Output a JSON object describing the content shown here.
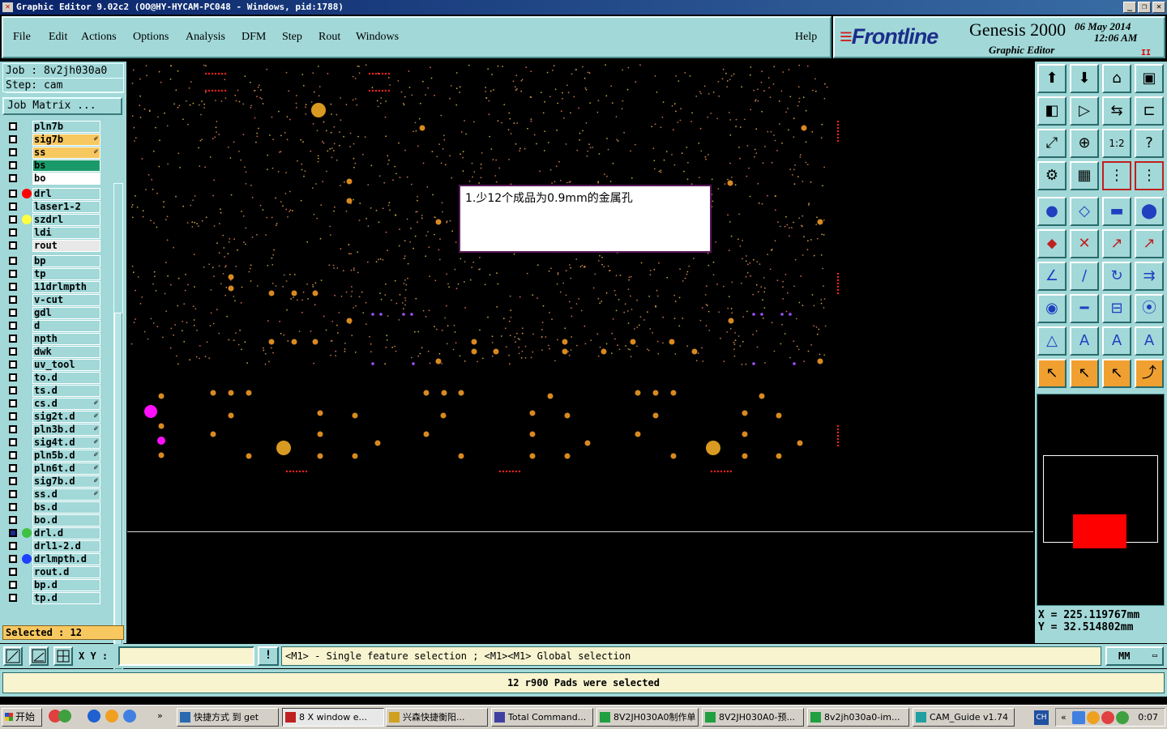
{
  "window": {
    "title": "Graphic Editor 9.02c2 (OO@HY-HYCAM-PC048 - Windows, pid:1788)",
    "controls": [
      "_",
      "❐",
      "✕"
    ]
  },
  "menu": {
    "items": [
      "File",
      "Edit",
      "Actions",
      "Options",
      "Analysis",
      "DFM",
      "Step",
      "Rout",
      "Windows"
    ],
    "help": "Help"
  },
  "brand": {
    "logo": "Frontline",
    "product": "Genesis 2000",
    "subtitle": "Graphic Editor",
    "date": "06 May 2014",
    "time": "12:06 AM",
    "pause": "II"
  },
  "job": {
    "job_line": "Job : 8v2jh030a0",
    "step_line": "Step: cam",
    "matrix_button": "Job Matrix ..."
  },
  "layers": [
    {
      "name": "pln7b",
      "bg": "#a2d8d8",
      "dot": "",
      "edit": false,
      "cb": "#ffffff"
    },
    {
      "name": "sig7b",
      "bg": "#f8c860",
      "dot": "",
      "edit": true,
      "cb": "#ffffff"
    },
    {
      "name": "ss",
      "bg": "#f8c860",
      "dot": "",
      "edit": true,
      "cb": "#ffffff"
    },
    {
      "name": "bs",
      "bg": "#1a9a6a",
      "dot": "",
      "edit": false,
      "cb": "#ffffff"
    },
    {
      "name": "bo",
      "bg": "#ffffff",
      "dot": "",
      "edit": false,
      "cb": "#ffffff"
    },
    {
      "name": "drl",
      "bg": "#a2d8d8",
      "dot": "#ff0000",
      "edit": false,
      "cb": "#ffffff"
    },
    {
      "name": "laser1-2",
      "bg": "#a2d8d8",
      "dot": "",
      "edit": false,
      "cb": "#ffffff"
    },
    {
      "name": "szdrl",
      "bg": "#a2d8d8",
      "dot": "#ffff40",
      "edit": false,
      "cb": "#ffffff"
    },
    {
      "name": "ldi",
      "bg": "#a2d8d8",
      "dot": "",
      "edit": false,
      "cb": "#ffffff"
    },
    {
      "name": "rout",
      "bg": "#e8e8e8",
      "dot": "",
      "edit": false,
      "cb": "#ffffff"
    },
    {
      "name": "bp",
      "bg": "#a2d8d8",
      "dot": "",
      "edit": false,
      "cb": "#ffffff"
    },
    {
      "name": "tp",
      "bg": "#a2d8d8",
      "dot": "",
      "edit": false,
      "cb": "#ffffff"
    },
    {
      "name": "11drlmpth",
      "bg": "#a2d8d8",
      "dot": "",
      "edit": false,
      "cb": "#ffffff"
    },
    {
      "name": "v-cut",
      "bg": "#a2d8d8",
      "dot": "",
      "edit": false,
      "cb": "#ffffff"
    },
    {
      "name": "gdl",
      "bg": "#a2d8d8",
      "dot": "",
      "edit": false,
      "cb": "#ffffff"
    },
    {
      "name": "d",
      "bg": "#a2d8d8",
      "dot": "",
      "edit": false,
      "cb": "#ffffff"
    },
    {
      "name": "npth",
      "bg": "#a2d8d8",
      "dot": "",
      "edit": false,
      "cb": "#ffffff"
    },
    {
      "name": "dwk",
      "bg": "#a2d8d8",
      "dot": "",
      "edit": false,
      "cb": "#ffffff"
    },
    {
      "name": "uv_tool",
      "bg": "#a2d8d8",
      "dot": "",
      "edit": false,
      "cb": "#ffffff"
    },
    {
      "name": "to.d",
      "bg": "#a2d8d8",
      "dot": "",
      "edit": false,
      "cb": "#ffffff"
    },
    {
      "name": "ts.d",
      "bg": "#a2d8d8",
      "dot": "",
      "edit": false,
      "cb": "#ffffff"
    },
    {
      "name": "cs.d",
      "bg": "#a2d8d8",
      "dot": "",
      "edit": true,
      "cb": "#ffffff"
    },
    {
      "name": "sig2t.d",
      "bg": "#a2d8d8",
      "dot": "",
      "edit": true,
      "cb": "#ffffff"
    },
    {
      "name": "pln3b.d",
      "bg": "#a2d8d8",
      "dot": "",
      "edit": true,
      "cb": "#ffffff"
    },
    {
      "name": "sig4t.d",
      "bg": "#a2d8d8",
      "dot": "",
      "edit": true,
      "cb": "#ffffff"
    },
    {
      "name": "pln5b.d",
      "bg": "#a2d8d8",
      "dot": "",
      "edit": true,
      "cb": "#ffffff"
    },
    {
      "name": "pln6t.d",
      "bg": "#a2d8d8",
      "dot": "",
      "edit": true,
      "cb": "#ffffff"
    },
    {
      "name": "sig7b.d",
      "bg": "#a2d8d8",
      "dot": "",
      "edit": true,
      "cb": "#ffffff"
    },
    {
      "name": "ss.d",
      "bg": "#a2d8d8",
      "dot": "",
      "edit": true,
      "cb": "#ffffff"
    },
    {
      "name": "bs.d",
      "bg": "#a2d8d8",
      "dot": "",
      "edit": false,
      "cb": "#ffffff"
    },
    {
      "name": "bo.d",
      "bg": "#a2d8d8",
      "dot": "",
      "edit": false,
      "cb": "#ffffff"
    },
    {
      "name": "drl.d",
      "bg": "#a2d8d8",
      "dot": "#40c040",
      "edit": false,
      "cb": "#1a2a8a"
    },
    {
      "name": "drl1-2.d",
      "bg": "#a2d8d8",
      "dot": "",
      "edit": false,
      "cb": "#ffffff"
    },
    {
      "name": "drlmpth.d",
      "bg": "#a2d8d8",
      "dot": "#2040ff",
      "edit": false,
      "cb": "#ffffff"
    },
    {
      "name": "rout.d",
      "bg": "#a2d8d8",
      "dot": "",
      "edit": false,
      "cb": "#ffffff"
    },
    {
      "name": "bp.d",
      "bg": "#a2d8d8",
      "dot": "",
      "edit": false,
      "cb": "#ffffff"
    },
    {
      "name": "tp.d",
      "bg": "#a2d8d8",
      "dot": "",
      "edit": false,
      "cb": "#ffffff"
    }
  ],
  "selected_label": "Selected : 12",
  "canvas": {
    "note": "1.少12个成品为0.9mm的金属孔"
  },
  "coords": {
    "x": "X = 225.119767mm",
    "y": "Y = 32.514802mm"
  },
  "bottom": {
    "xy_label": "X Y :",
    "xy_value": "",
    "bang": "!",
    "hint": "<M1> - Single feature selection ; <M1><M1> Global selection",
    "unit": "MM",
    "message": "12 r900 Pads were selected"
  },
  "taskbar": {
    "start": "开始",
    "tasks": [
      "快捷方式 到 get",
      "8 X window e...",
      "兴森快捷衡阳...",
      "Total Command...",
      "8V2JH030A0制作单",
      "8V2JH030A0-预...",
      "8v2jh030a0-im...",
      "CAM_Guide v1.74"
    ],
    "lang": "CH",
    "clock": "0:07"
  },
  "colors": {
    "panel": "#a2d8d8",
    "highlight": "#f8c860",
    "pads": "#d89020",
    "selected_pads": "#ff00ff"
  },
  "icons": [
    "open-job-icon",
    "save-icon",
    "home-icon",
    "windows-icon",
    "zoom-back-icon",
    "zoom-forward-icon",
    "mirror-icon",
    "snap-icon",
    "fit-icon",
    "center-icon",
    "scale-icon",
    "help-icon",
    "measure-icon",
    "grid-icon",
    "layer-compare-icon",
    "layer-compare2-icon",
    "add-pad-icon",
    "add-line-icon",
    "ruler-icon",
    "pad-select-icon",
    "net-icon",
    "cross-icon",
    "node-icon",
    "node2-icon",
    "angle-icon",
    "line-icon",
    "arc-icon",
    "text-icon",
    "pad-move-icon",
    "slot-icon",
    "resize-icon",
    "connect-icon",
    "triangle-a-icon",
    "triangle-b-icon",
    "triangle-c-icon",
    "triangle-d-icon",
    "select-arrow-icon",
    "select-box-icon",
    "select-net-icon",
    "route-icon"
  ]
}
